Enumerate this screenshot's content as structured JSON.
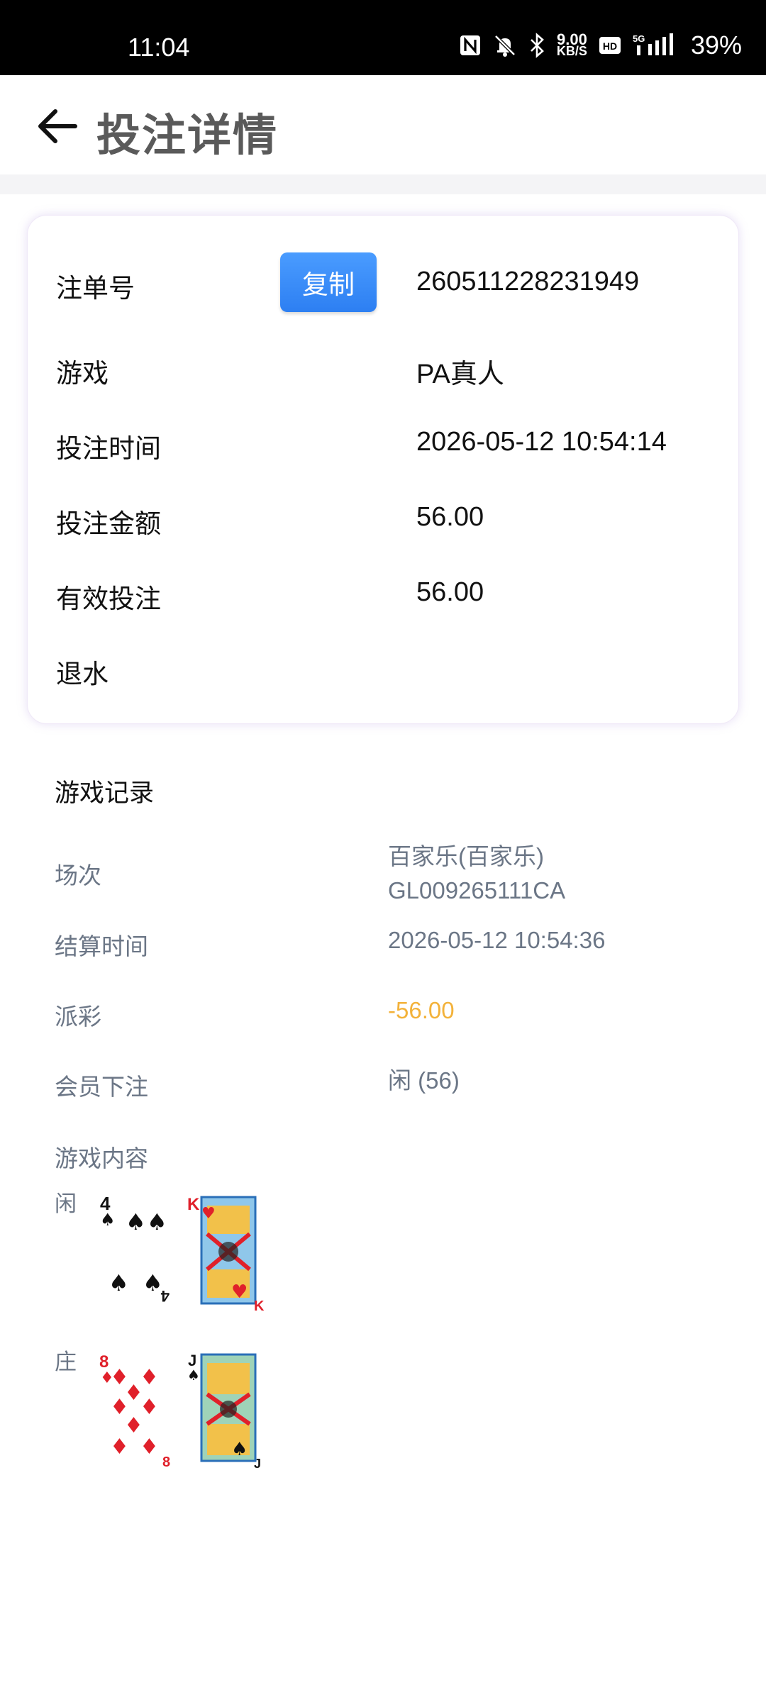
{
  "status_bar": {
    "time": "11:04",
    "net_speed_value": "9.00",
    "net_speed_unit": "KB/S",
    "network": "5G",
    "battery": "39%",
    "icons": [
      "nfc-icon",
      "silent-icon",
      "bluetooth-icon",
      "hd-icon",
      "signal-icon"
    ]
  },
  "header": {
    "title": "投注详情",
    "back_icon": "arrow-left-icon"
  },
  "bet_card": {
    "order_label": "注单号",
    "copy_label": "复制",
    "order_value": "260511228231949",
    "game_label": "游戏",
    "game_value": "PA真人",
    "bet_time_label": "投注时间",
    "bet_time_value": "2026-05-12 10:54:14",
    "bet_amount_label": "投注金额",
    "bet_amount_value": "56.00",
    "valid_bet_label": "有效投注",
    "valid_bet_value": "56.00",
    "rebate_label": "退水",
    "rebate_value": ""
  },
  "game_record": {
    "title": "游戏记录",
    "round_label": "场次",
    "round_value_line1": "百家乐(百家乐)",
    "round_value_line2": "GL009265111CA",
    "settle_time_label": "结算时间",
    "settle_time_value": "2026-05-12 10:54:36",
    "payout_label": "派彩",
    "payout_value": "-56.00",
    "member_bet_label": "会员下注",
    "member_bet_value": "闲 (56)",
    "content_label": "游戏内容",
    "player_label": "闲",
    "banker_label": "庄",
    "player_cards": [
      {
        "rank": "4",
        "suit": "♠",
        "color": "#111111"
      },
      {
        "rank": "K",
        "suit": "♥",
        "color": "#e0202a"
      }
    ],
    "banker_cards": [
      {
        "rank": "8",
        "suit": "♦",
        "color": "#e0202a"
      },
      {
        "rank": "J",
        "suit": "♠",
        "color": "#111111"
      }
    ]
  },
  "colors": {
    "copy_button": "#3b8cfb",
    "payout_negative": "#f3b23a",
    "secondary_text": "#6b7686"
  }
}
